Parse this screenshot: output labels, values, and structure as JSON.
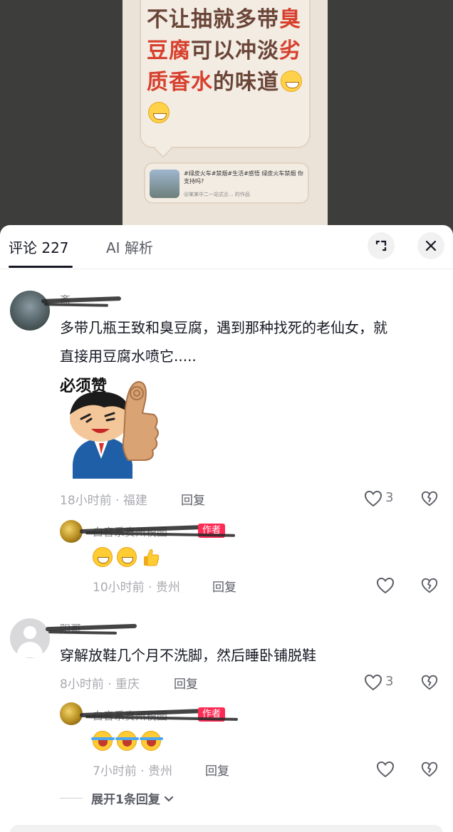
{
  "video": {
    "headline_parts": [
      {
        "text": "不让抽就多带",
        "red": false
      },
      {
        "text": "臭豆腐",
        "red": true
      },
      {
        "text": "可以冲淡",
        "red": false
      },
      {
        "text": "劣质香水",
        "red": true
      },
      {
        "text": "的味道",
        "red": false
      }
    ],
    "mini_card_text": "#绿皮火车#禁烟#生活#感悟  绿皮火车禁烟 你支持吗?",
    "mini_card_sub": "@某某中二一站式企... 的作品"
  },
  "tabs": {
    "comments_label": "评论 227",
    "ai_label": "AI 解析"
  },
  "comments": [
    {
      "username": "斋",
      "text_line1": "多带几瓶王致和臭豆腐，遇到那种找死的老仙女，就",
      "text_line2": "直接用豆腐水喷它.....",
      "sticker_caption": "必须赞",
      "time_location": "18小时前 · 福建",
      "reply_label": "回复",
      "like_count": "3",
      "reply": {
        "username": "白音系贵州税园",
        "author_tag": "作者",
        "time_location": "10小时前 · 贵州",
        "reply_label": "回复"
      }
    },
    {
      "username": "阳哥",
      "text": "穿解放鞋几个月不洗脚，然后睡卧铺脱鞋",
      "time_location": "8小时前 · 重庆",
      "reply_label": "回复",
      "like_count": "3",
      "reply": {
        "username": "白音系贵州税园",
        "author_tag": "作者",
        "time_location": "7小时前 · 贵州",
        "reply_label": "回复"
      }
    }
  ],
  "expand_label": "展开1条回复",
  "colors": {
    "accent": "#fe2c55",
    "headline_brown": "#6a4538",
    "headline_red": "#d7402e"
  }
}
